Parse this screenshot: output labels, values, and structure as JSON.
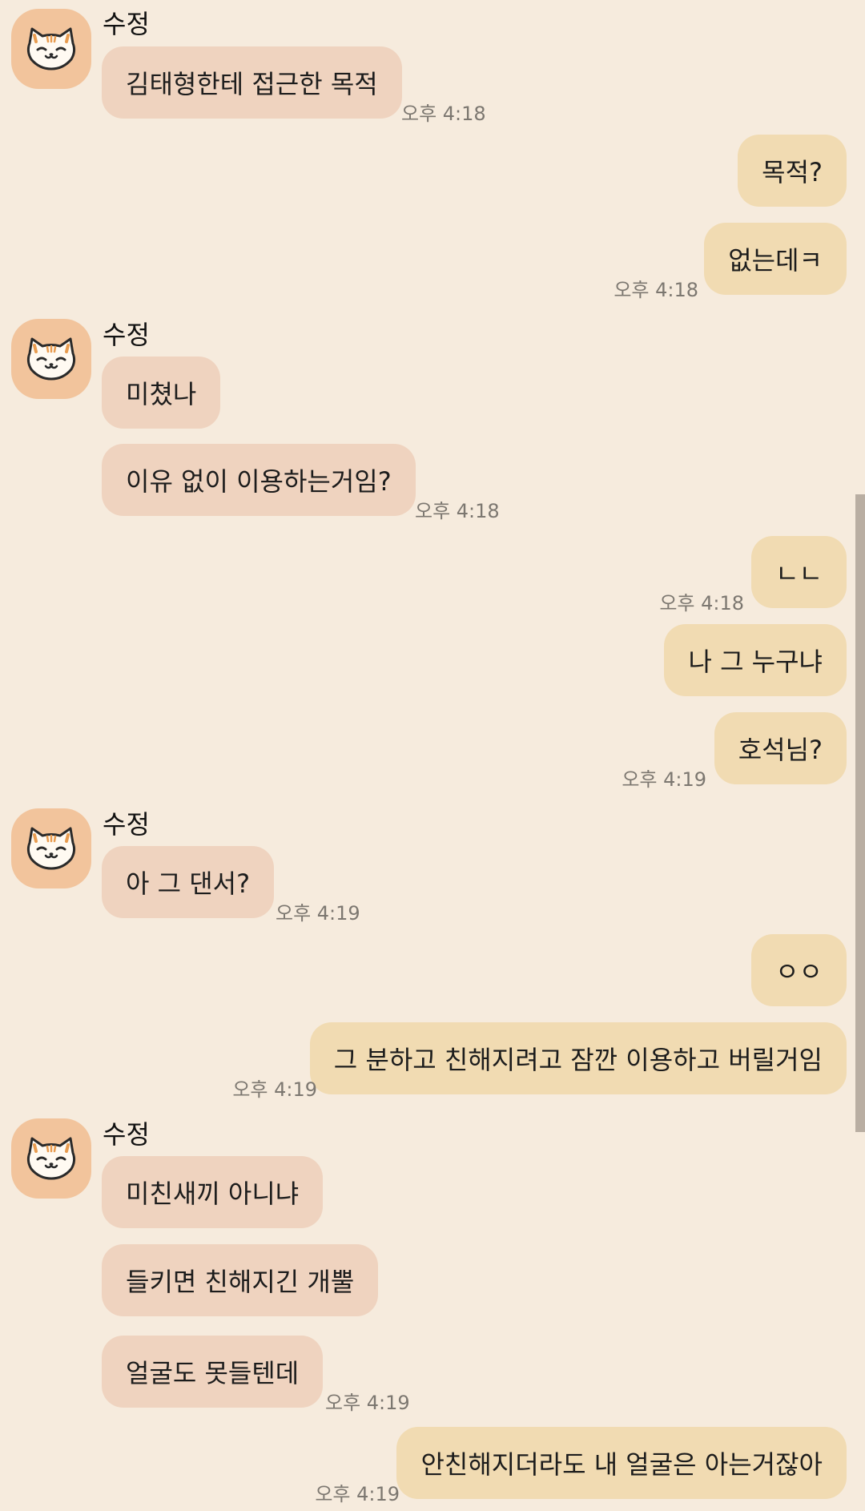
{
  "contact": {
    "name": "수정",
    "avatar_icon": "cat-face-icon"
  },
  "messages": [
    {
      "side": "in",
      "text": "김태형한테 접근한 목적"
    },
    {
      "side": "in",
      "time": "오후 4:18"
    },
    {
      "side": "out",
      "text": "목적?"
    },
    {
      "side": "out",
      "text": "없는데ㅋ"
    },
    {
      "side": "out",
      "time": "오후 4:18"
    },
    {
      "side": "in",
      "text": "미쳤나"
    },
    {
      "side": "in",
      "text": "이유 없이 이용하는거임?"
    },
    {
      "side": "in",
      "time": "오후 4:18"
    },
    {
      "side": "out",
      "text": "ㄴㄴ"
    },
    {
      "side": "out",
      "time": "오후 4:18"
    },
    {
      "side": "out",
      "text": "나 그 누구냐"
    },
    {
      "side": "out",
      "text": "호석님?"
    },
    {
      "side": "out",
      "time": "오후 4:19"
    },
    {
      "side": "in",
      "text": "아 그 댄서?"
    },
    {
      "side": "in",
      "time": "오후 4:19"
    },
    {
      "side": "out",
      "text": "ㅇㅇ"
    },
    {
      "side": "out",
      "text": "그 분하고 친해지려고 잠깐 이용하고 버릴거임"
    },
    {
      "side": "out",
      "time": "오후 4:19"
    },
    {
      "side": "in",
      "text": "미친새끼 아니냐"
    },
    {
      "side": "in",
      "text": "들키면 친해지긴 개뿔"
    },
    {
      "side": "in",
      "text": "얼굴도 못들텐데"
    },
    {
      "side": "in",
      "time": "오후 4:19"
    },
    {
      "side": "out",
      "text": "안친해지더라도 내 얼굴은 아는거잖아"
    },
    {
      "side": "out",
      "time": "오후 4:19"
    }
  ],
  "colors": {
    "background": "#f6ebdd",
    "incoming_bubble": "#efd3bf",
    "outgoing_bubble": "#f1dbb2",
    "avatar_bg": "#f2c49c",
    "timestamp": "#7c7770"
  }
}
